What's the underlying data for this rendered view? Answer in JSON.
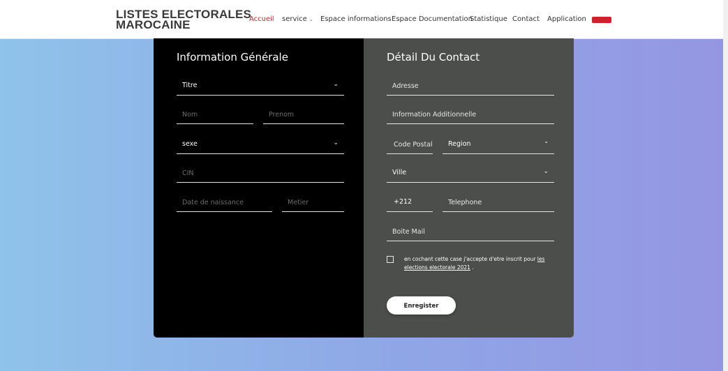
{
  "header": {
    "logo_line1": "LISTES ELECTORALES",
    "logo_line2": "MAROCAINE",
    "nav": [
      {
        "label": "Accueil",
        "active": true
      },
      {
        "label": "service",
        "dropdown": true
      },
      {
        "label": "Espace informations"
      },
      {
        "label": "Espace Documentation"
      },
      {
        "label": "Statistique"
      },
      {
        "label": "Contact"
      },
      {
        "label": "Application"
      }
    ],
    "flag_color": "#d11f2b",
    "accent_color": "#c0282f"
  },
  "left_panel": {
    "title": "Information Générale",
    "titre_select": "Titre",
    "nom_placeholder": "Nom",
    "prenom_placeholder": "Prenom",
    "sexe_select": "sexe",
    "cin_placeholder": "CIN",
    "date_placeholder": "Date de naissance",
    "metier_placeholder": "Metier"
  },
  "right_panel": {
    "title": "Détail Du Contact",
    "adresse_placeholder": "Adresse",
    "info_placeholder": "Information Additionnelle",
    "code_postal_placeholder": "Code Postal",
    "region_select": "Region",
    "ville_select": "Ville",
    "prefix_value": "+212",
    "telephone_placeholder": "Telephone",
    "mail_placeholder": "Boite Mail",
    "consent_text": "en cochant cette case j'accepte d'etre inscrit pour ",
    "consent_link": "les elections electorale 2021",
    "consent_end": " .",
    "save_label": "Enregister"
  },
  "icons": {
    "dropdown": "chevron-down-icon"
  }
}
